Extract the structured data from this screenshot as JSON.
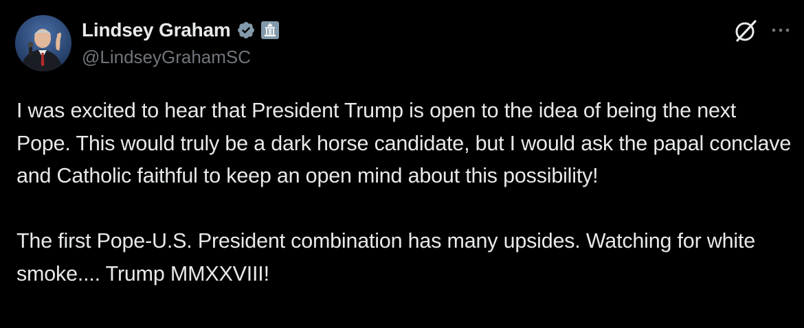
{
  "author": {
    "display_name": "Lindsey Graham",
    "handle": "@LindseyGrahamSC",
    "verified_icon": "verified-badge-icon",
    "affiliation_icon": "government-building-icon"
  },
  "actions": {
    "grok_icon": "grok-icon",
    "more_icon": "more-options-icon"
  },
  "tweet": {
    "paragraphs": [
      "I was excited to hear that President Trump is open to the idea of being the next Pope. This would truly be a dark horse candidate, but I would ask the papal conclave and Catholic faithful to keep an open mind about this possibility!",
      "The first Pope-U.S. President combination has many upsides. Watching for white smoke.... Trump MMXXVIII!"
    ]
  },
  "colors": {
    "background": "#000000",
    "text_primary": "#e7e9ea",
    "text_secondary": "#71767b",
    "verified_badge": "#829aab",
    "gov_badge": "#829aab"
  }
}
